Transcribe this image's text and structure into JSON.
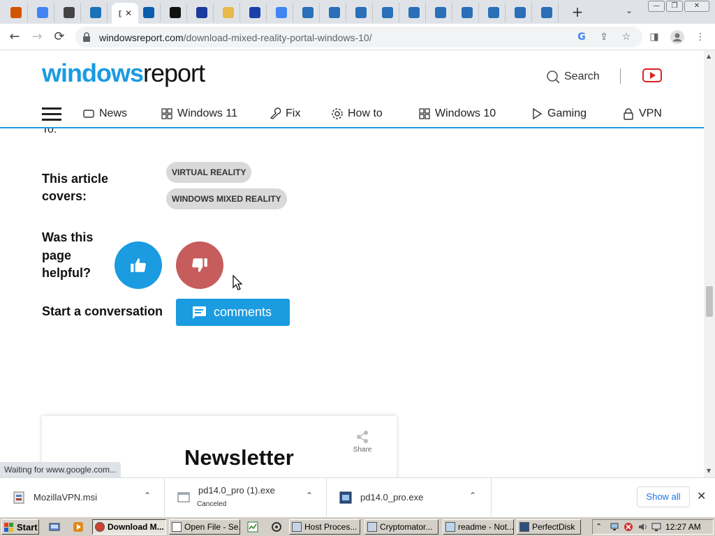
{
  "browser": {
    "tabs": [
      {
        "icon": "firefox-favicon",
        "color": "#d35400"
      },
      {
        "icon": "google-favicon",
        "color": "#4285f4"
      },
      {
        "icon": "person-favicon",
        "color": "#444444"
      },
      {
        "icon": "book-favicon",
        "color": "#1a73b8"
      },
      {
        "icon": "windowsreport-favicon",
        "color": "#1b9be0",
        "active": true
      },
      {
        "icon": "app-favicon",
        "color": "#0b5cad"
      },
      {
        "icon": "gear-favicon",
        "color": "#111111"
      },
      {
        "icon": "arrow-favicon",
        "color": "#1a3a9c"
      },
      {
        "icon": "cloud-favicon",
        "color": "#e8b84a"
      },
      {
        "icon": "s-favicon",
        "color": "#1b3fa8"
      },
      {
        "icon": "google-favicon",
        "color": "#4285f4"
      },
      {
        "icon": "windowsreport-favicon",
        "color": "#2a6fb8"
      },
      {
        "icon": "windowsreport-favicon",
        "color": "#2a6fb8"
      },
      {
        "icon": "windowsreport-favicon",
        "color": "#2a6fb8"
      },
      {
        "icon": "windowsreport-favicon",
        "color": "#2a6fb8"
      },
      {
        "icon": "windowsreport-favicon",
        "color": "#2a6fb8"
      },
      {
        "icon": "windowsreport-favicon",
        "color": "#2a6fb8"
      },
      {
        "icon": "windowsreport-favicon",
        "color": "#2a6fb8"
      },
      {
        "icon": "windowsreport-favicon",
        "color": "#2a6fb8"
      },
      {
        "icon": "windowsreport-favicon",
        "color": "#2a6fb8"
      },
      {
        "icon": "windowsreport-favicon",
        "color": "#2a6fb8"
      }
    ],
    "active_tab_label": "[",
    "tab_close_glyph": "✕",
    "new_tab_glyph": "+",
    "tab_search_glyph": "⌄",
    "window_controls": {
      "minimize": "—",
      "maximize": "❐",
      "close": "✕"
    },
    "url_host": "windowsreport.com",
    "url_path": "/download-mixed-reality-portal-windows-10/",
    "nav": {
      "back": "←",
      "forward": "→",
      "stop": "⟳"
    },
    "status_text": "Waiting for www.google.com..."
  },
  "site": {
    "logo_windows": "windows",
    "logo_report": "report",
    "search_label": "Search",
    "menu": [
      {
        "label": "News",
        "icon": "news-icon"
      },
      {
        "label": "Windows 11",
        "icon": "windows-icon"
      },
      {
        "label": "Fix",
        "icon": "wrench-icon"
      },
      {
        "label": "How to",
        "icon": "gear-icon"
      },
      {
        "label": "Windows 10",
        "icon": "windows-icon"
      },
      {
        "label": "Gaming",
        "icon": "play-icon"
      },
      {
        "label": "VPN",
        "icon": "lock-icon"
      }
    ],
    "cut_text": "To:",
    "covers_label": "This article covers:",
    "tags": [
      "VIRTUAL REALITY",
      "WINDOWS MIXED REALITY"
    ],
    "helpful_label": "Was this page helpful?",
    "conversation_label": "Start a conversation",
    "comments_label": "comments",
    "newsletter_title": "Newsletter",
    "share_label": "Share",
    "accent_color": "#1b9be0",
    "dislike_color": "#c75c5c"
  },
  "downloads": {
    "items": [
      {
        "name": "MozillaVPN.msi",
        "status": ""
      },
      {
        "name": "pd14.0_pro (1).exe",
        "status": "Canceled"
      },
      {
        "name": "pd14.0_pro.exe",
        "status": ""
      }
    ],
    "show_all_label": "Show all",
    "close_glyph": "✕",
    "chevron_glyph": "⌃"
  },
  "taskbar": {
    "start_label": "Start",
    "buttons": [
      {
        "label": "Download M...",
        "icon": "chrome-icon",
        "active": true
      },
      {
        "label": "Open File - Se...",
        "icon": "document-icon",
        "active": false
      },
      {
        "label": "Host Proces...",
        "icon": "window-icon",
        "active": false
      },
      {
        "label": "Cryptomator...",
        "icon": "window-icon",
        "active": false
      },
      {
        "label": "readme - Not...",
        "icon": "notepad-icon",
        "active": false
      },
      {
        "label": "PerfectDisk",
        "icon": "pd-icon",
        "active": false
      }
    ],
    "clock": "12:27 AM"
  }
}
